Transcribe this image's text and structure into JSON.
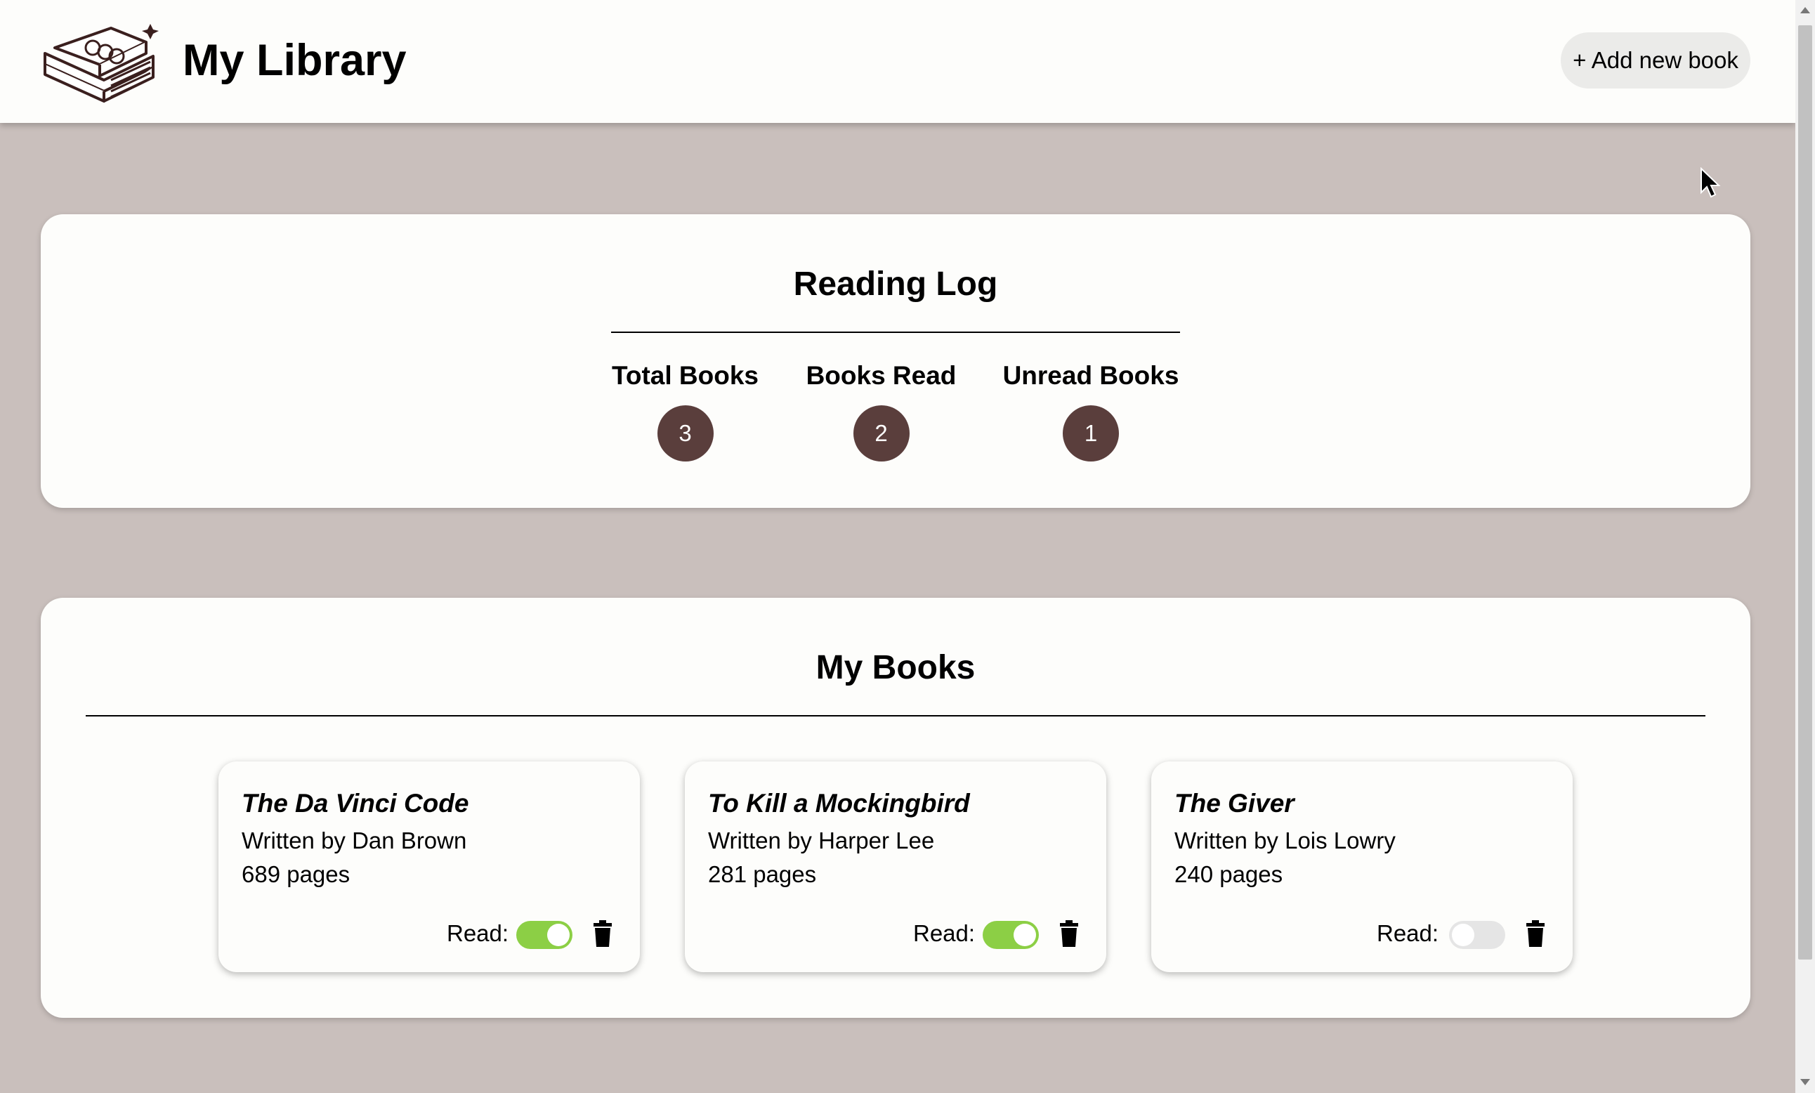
{
  "header": {
    "title": "My Library",
    "logo_icon": "books-icon",
    "add_button_label": "+ Add new book"
  },
  "reading_log": {
    "title": "Reading Log",
    "stats": [
      {
        "label": "Total Books",
        "value": "3"
      },
      {
        "label": "Books Read",
        "value": "2"
      },
      {
        "label": "Unread Books",
        "value": "1"
      }
    ]
  },
  "my_books": {
    "title": "My Books",
    "books": [
      {
        "title": "The Da Vinci Code",
        "author": "Written by Dan Brown",
        "pages": "689 pages",
        "read_label": "Read:",
        "read": true
      },
      {
        "title": "To Kill a Mockingbird",
        "author": "Written by Harper Lee",
        "pages": "281 pages",
        "read_label": "Read:",
        "read": true
      },
      {
        "title": "The Giver",
        "author": "Written by Lois Lowry",
        "pages": "240 pages",
        "read_label": "Read:",
        "read": false
      }
    ]
  },
  "colors": {
    "page_background": "#c9bfbc",
    "badge": "#5a3e3c",
    "toggle_on": "#8ccf45",
    "toggle_off": "#e5e5e5"
  }
}
